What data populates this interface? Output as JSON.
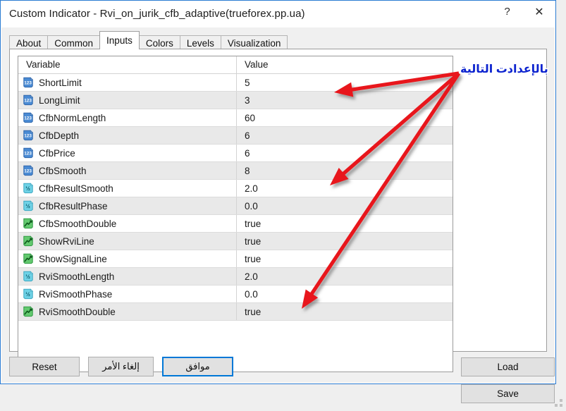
{
  "window": {
    "title": "Custom Indicator - Rvi_on_jurik_cfb_adaptive(trueforex.pp.ua)",
    "help_glyph": "?",
    "close_glyph": "✕"
  },
  "tabs": [
    {
      "label": "About",
      "active": false
    },
    {
      "label": "Common",
      "active": false
    },
    {
      "label": "Inputs",
      "active": true
    },
    {
      "label": "Colors",
      "active": false
    },
    {
      "label": "Levels",
      "active": false
    },
    {
      "label": "Visualization",
      "active": false
    }
  ],
  "grid": {
    "headers": {
      "variable": "Variable",
      "value": "Value"
    },
    "rows": [
      {
        "icon": "integer-icon",
        "name": "ShortLimit",
        "value": "5"
      },
      {
        "icon": "integer-icon",
        "name": "LongLimit",
        "value": "3"
      },
      {
        "icon": "integer-icon",
        "name": "CfbNormLength",
        "value": "60"
      },
      {
        "icon": "integer-icon",
        "name": "CfbDepth",
        "value": "6"
      },
      {
        "icon": "integer-icon",
        "name": "CfbPrice",
        "value": "6"
      },
      {
        "icon": "integer-icon",
        "name": "CfbSmooth",
        "value": "8"
      },
      {
        "icon": "double-icon",
        "name": "CfbResultSmooth",
        "value": "2.0"
      },
      {
        "icon": "double-icon",
        "name": "CfbResultPhase",
        "value": "0.0"
      },
      {
        "icon": "boolean-icon",
        "name": "CfbSmoothDouble",
        "value": "true"
      },
      {
        "icon": "boolean-icon",
        "name": "ShowRviLine",
        "value": "true"
      },
      {
        "icon": "boolean-icon",
        "name": "ShowSignalLine",
        "value": "true"
      },
      {
        "icon": "double-icon",
        "name": "RviSmoothLength",
        "value": "2.0"
      },
      {
        "icon": "double-icon",
        "name": "RviSmoothPhase",
        "value": "0.0"
      },
      {
        "icon": "boolean-icon",
        "name": "RviSmoothDouble",
        "value": "true"
      }
    ]
  },
  "side_buttons": {
    "load": "Load",
    "save": "Save"
  },
  "footer_buttons": {
    "reset": "Reset",
    "cancel": "إلغاء الأمر",
    "ok": "موافق"
  },
  "annotation": {
    "text": "بالإعدادت التالية",
    "color": "#0c23cf",
    "arrow_color": "#e8191b",
    "arrow_count": 3
  },
  "colors": {
    "window_border": "#2b7cd3",
    "accent": "#0078d7",
    "row_alt": "#e9e9e9",
    "integer_icon": "#3f7fd0",
    "double_icon": "#5bc8de",
    "boolean_icon": "#4fbf5c"
  }
}
